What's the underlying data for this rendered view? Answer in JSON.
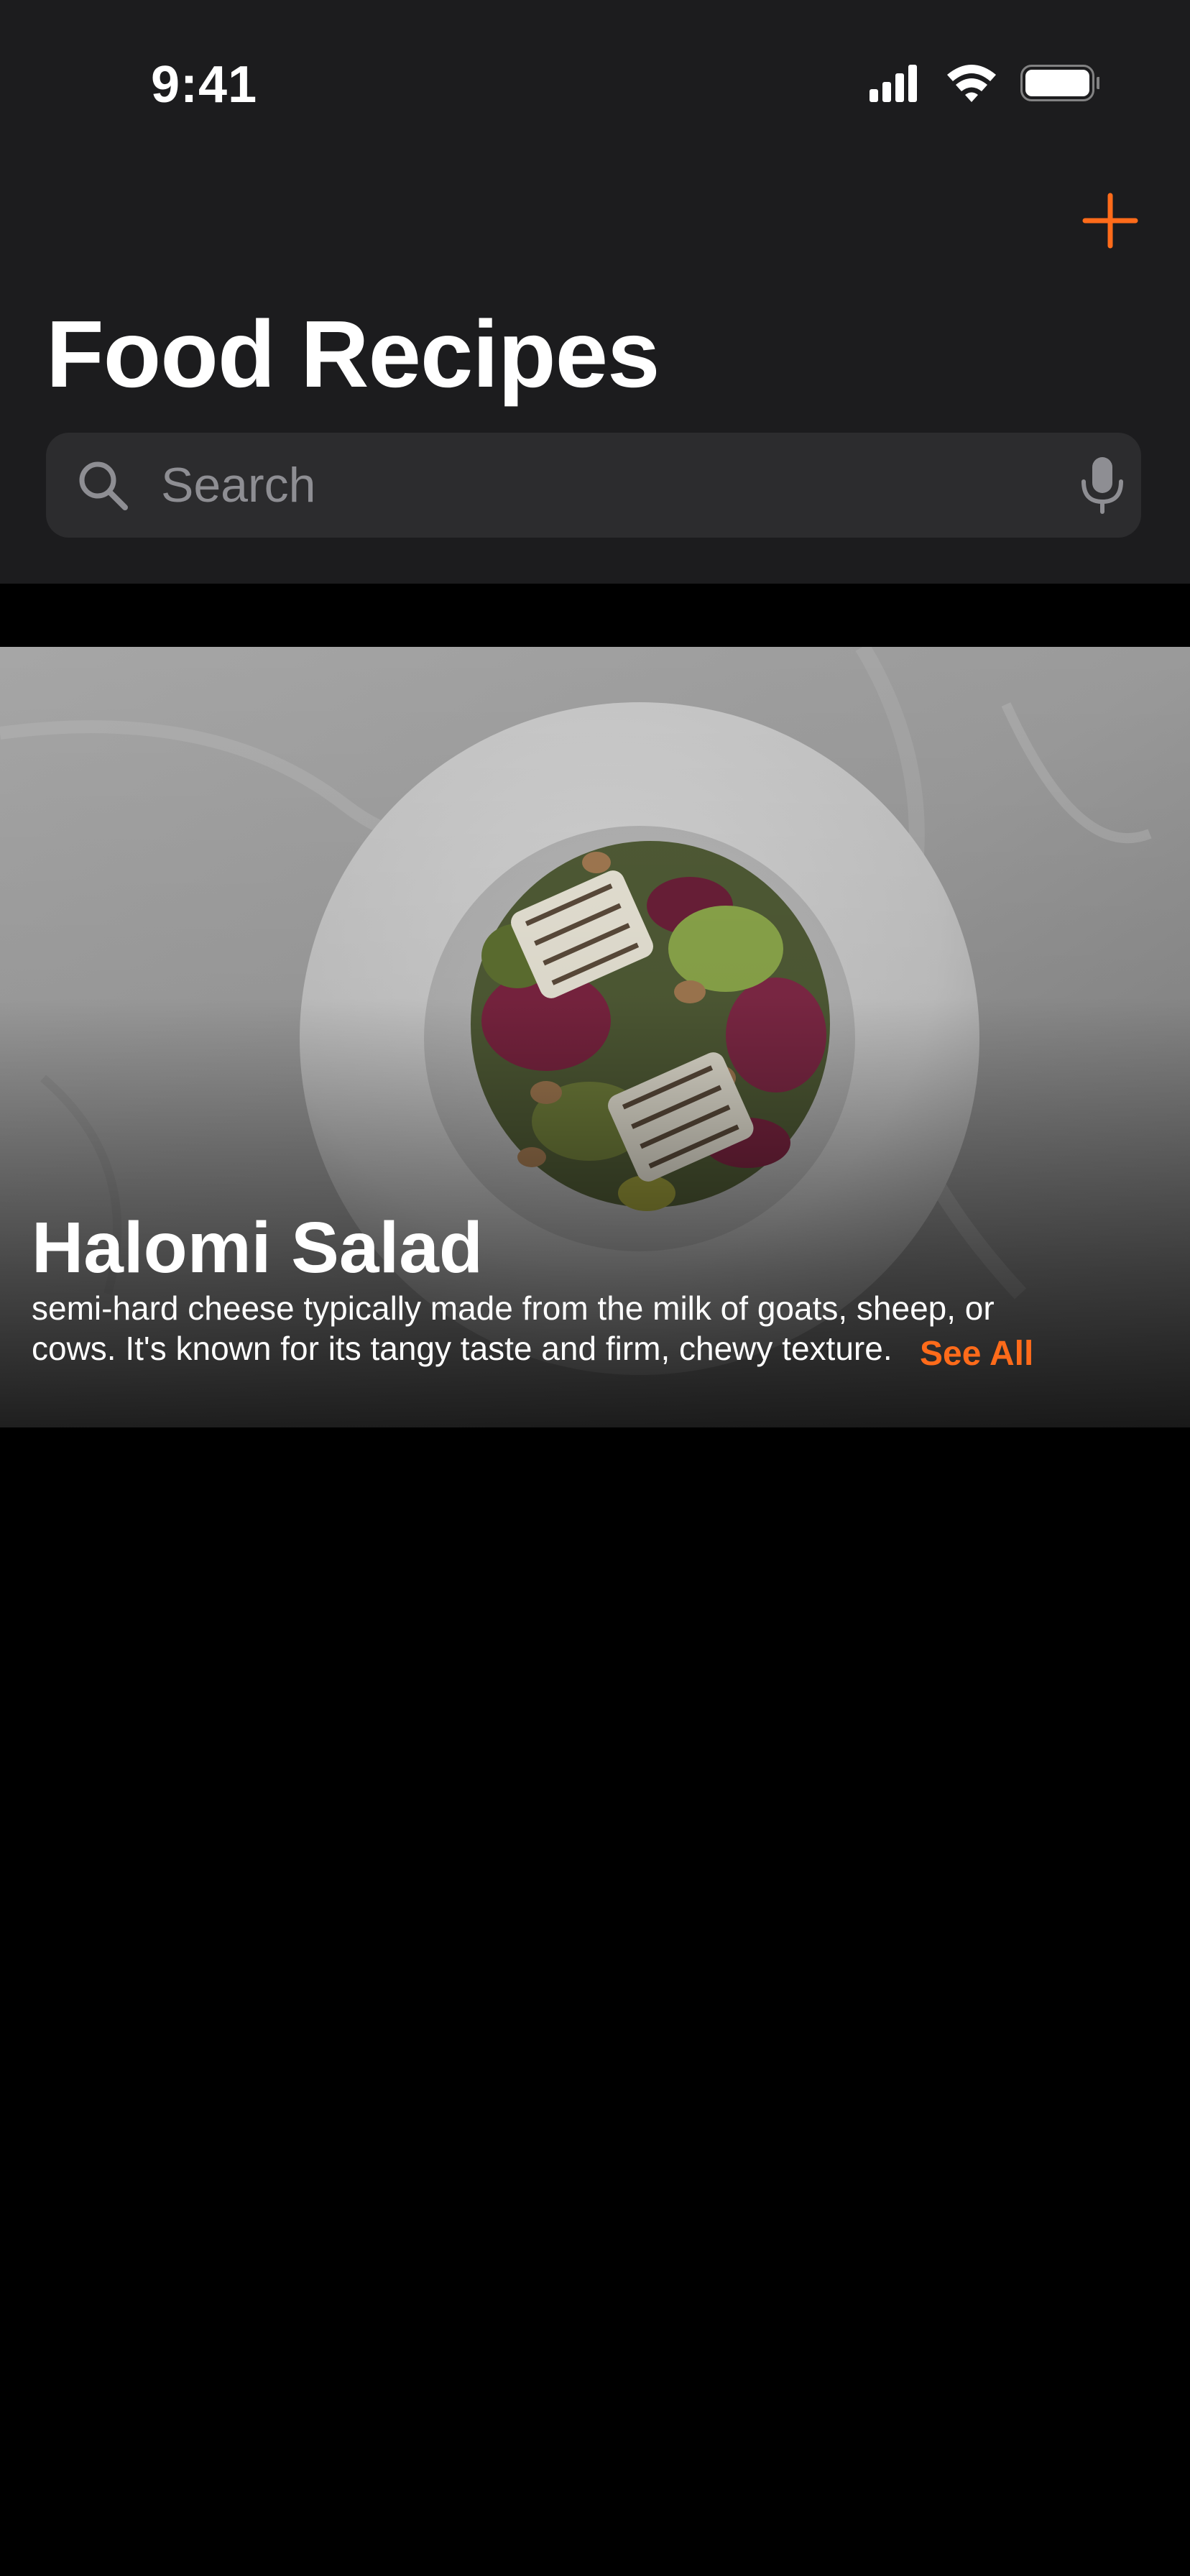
{
  "status_bar": {
    "time": "9:41",
    "icons": [
      "cellular-signal-icon",
      "wifi-icon",
      "battery-icon"
    ]
  },
  "header": {
    "title": "Food Recipes",
    "add_icon": "plus-icon",
    "accent_color": "#ff6b1a",
    "background_color": "#1c1c1e"
  },
  "search": {
    "placeholder": "Search",
    "value": "",
    "icon": "search-icon",
    "mic_icon": "microphone-icon"
  },
  "featured_recipe": {
    "title": "Halomi Salad",
    "description_lines": [
      " semi-hard cheese typically made from the milk of goats, sheep, or",
      "cows. It's known for its tangy taste and firm, chewy texture."
    ],
    "see_all_label": "See All",
    "image": "grilled-halloumi-salad-plate-photo"
  }
}
